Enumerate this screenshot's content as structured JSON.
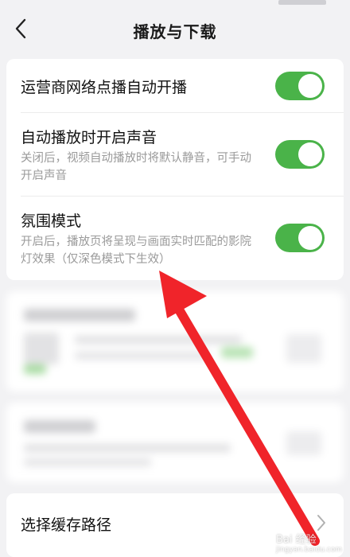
{
  "header": {
    "title": "播放与下载"
  },
  "settings": [
    {
      "title": "运营商网络点播自动开播",
      "subtitle": "",
      "enabled": true
    },
    {
      "title": "自动播放时开启声音",
      "subtitle": "关闭后，视频自动播放时将默认静音，可手动开启声音",
      "enabled": true
    },
    {
      "title": "氛围模式",
      "subtitle": "开启后，播放页将呈现与画面实时匹配的影院灯效果（仅深色模式下生效）",
      "enabled": true
    }
  ],
  "cache_path": {
    "title": "选择缓存路径"
  },
  "watermark": {
    "text": "Bai 经验",
    "sub": "jingyan.baidu.com"
  },
  "colors": {
    "toggle_on": "#4ab349",
    "arrow": "#f0242a",
    "background": "#f2f2f4"
  }
}
